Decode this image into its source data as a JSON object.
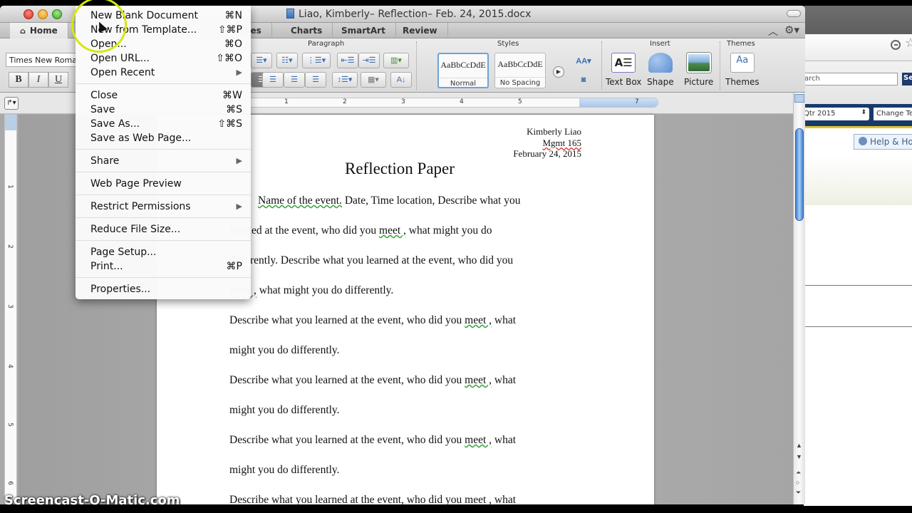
{
  "window": {
    "title": "Liao, Kimberly– Reflection– Feb. 24, 2015.docx"
  },
  "ribbon_tabs": [
    {
      "label": "Home",
      "icon": "home-icon"
    },
    {
      "label": "Tables"
    },
    {
      "label": "Charts"
    },
    {
      "label": "SmartArt"
    },
    {
      "label": "Review"
    }
  ],
  "ribbon": {
    "font_name": "Times New Roman",
    "format_buttons": [
      "B",
      "I",
      "U"
    ],
    "groups": {
      "paragraph": "Paragraph",
      "styles": "Styles",
      "insert": "Insert",
      "themes": "Themes"
    },
    "styles": [
      {
        "sample": "AaBbCcDdE",
        "name": "Normal",
        "selected": true
      },
      {
        "sample": "AaBbCcDdE",
        "name": "No Spacing",
        "selected": false
      }
    ],
    "insert_items": [
      {
        "label": "Text Box",
        "icon": "text-box-icon"
      },
      {
        "label": "Shape",
        "icon": "shape-icon"
      },
      {
        "label": "Picture",
        "icon": "picture-icon"
      }
    ],
    "themes_item": {
      "label": "Themes",
      "icon": "themes-icon",
      "glyph": "Aa"
    }
  },
  "ruler": {
    "horizontal_numbers": [
      "1",
      "2",
      "3",
      "4",
      "5",
      "7"
    ],
    "vertical_numbers": [
      "1",
      "2",
      "3",
      "4",
      "5",
      "6"
    ]
  },
  "file_menu": {
    "groups": [
      [
        {
          "label": "New Blank Document",
          "shortcut": "⌘N"
        },
        {
          "label": "New from Template...",
          "shortcut": "⇧⌘P"
        },
        {
          "label": "Open...",
          "shortcut": "⌘O"
        },
        {
          "label": "Open URL...",
          "shortcut": "⇧⌘O"
        },
        {
          "label": "Open Recent",
          "submenu": true
        }
      ],
      [
        {
          "label": "Close",
          "shortcut": "⌘W"
        },
        {
          "label": "Save",
          "shortcut": "⌘S"
        },
        {
          "label": "Save As...",
          "shortcut": "⇧⌘S"
        },
        {
          "label": "Save as Web Page..."
        }
      ],
      [
        {
          "label": "Share",
          "submenu": true
        }
      ],
      [
        {
          "label": "Web Page Preview"
        }
      ],
      [
        {
          "label": "Restrict Permissions",
          "submenu": true
        }
      ],
      [
        {
          "label": "Reduce File Size..."
        }
      ],
      [
        {
          "label": "Page Setup..."
        },
        {
          "label": "Print...",
          "shortcut": "⌘P"
        }
      ],
      [
        {
          "label": "Properties..."
        }
      ]
    ]
  },
  "document": {
    "header_lines": [
      "Kimberly Liao",
      "Mgmt 165",
      "February 24, 2015"
    ],
    "heading": "Reflection Paper",
    "lines": [
      {
        "pre": "",
        "squig": "Name of the event.",
        "post": " Date, Time location, Describe what you",
        "indent": true
      },
      {
        "pre": "learned at the event, who did you ",
        "squig": "meet ,",
        "post": " what might you do"
      },
      {
        "pre": "differently. Describe what you learned at the event, who did you",
        "squig": "",
        "post": ""
      },
      {
        "pre": "",
        "squig": "meet ,",
        "post": " what might you do differently."
      },
      {
        "pre": "Describe what you learned at the event, who did you ",
        "squig": "meet ,",
        "post": " what"
      },
      {
        "pre": "might you do differently.",
        "squig": "",
        "post": ""
      },
      {
        "pre": "Describe what you learned at the event, who did you ",
        "squig": "meet ,",
        "post": " what"
      },
      {
        "pre": "might you do differently.",
        "squig": "",
        "post": ""
      },
      {
        "pre": "Describe what you learned at the event, who did you ",
        "squig": "meet ,",
        "post": " what"
      },
      {
        "pre": "might you do differently.",
        "squig": "",
        "post": ""
      },
      {
        "pre": "Describe what you learned at the event, who did you meet , what",
        "squig": "",
        "post": ""
      }
    ]
  },
  "browser": {
    "search_placeholder": "arch",
    "search_button": "Se",
    "quarter_select": "Qtr 2015",
    "change_button": "Change Te",
    "help_button": "Help & Ho"
  },
  "watermark": "Screencast-O-Matic.com"
}
